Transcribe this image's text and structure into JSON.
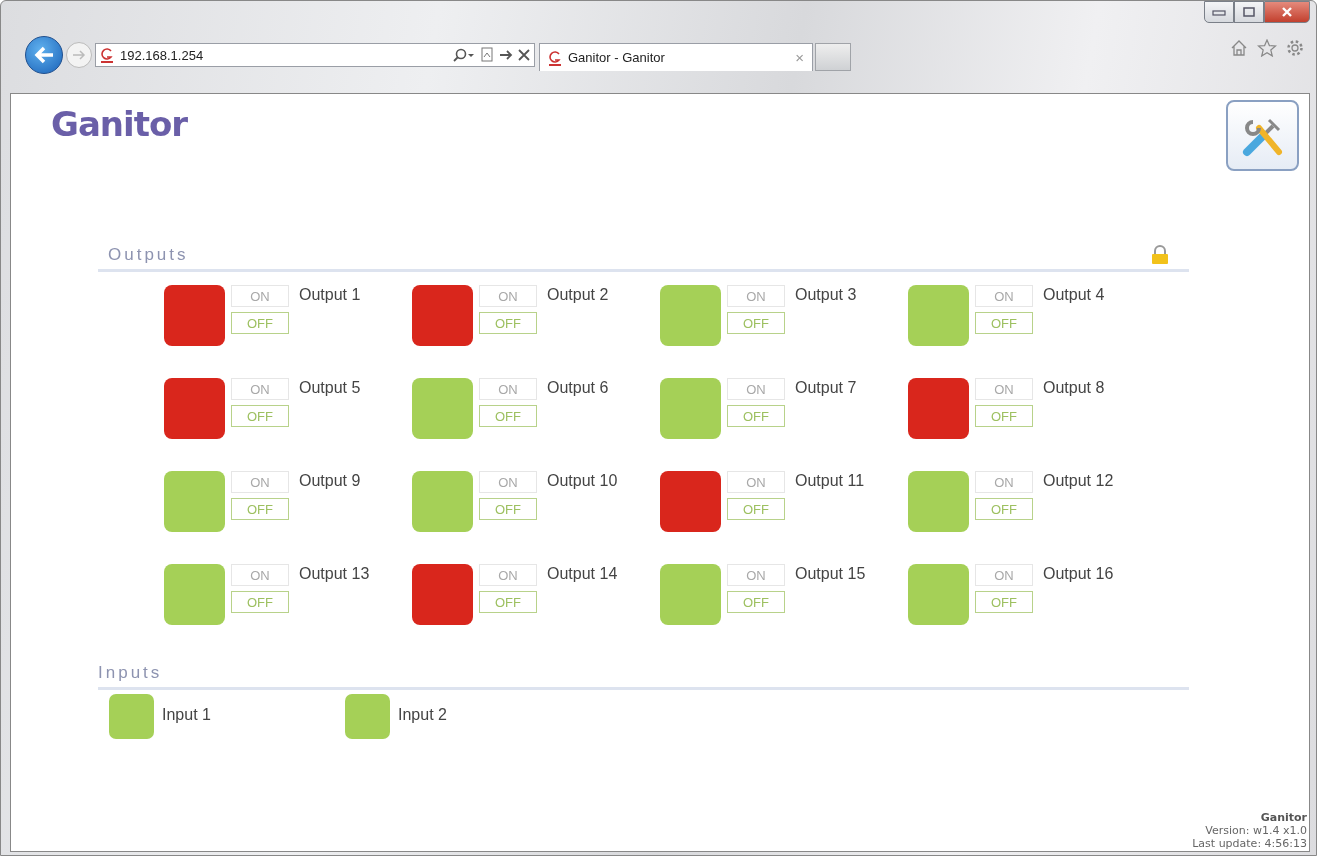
{
  "browser": {
    "address": "192.168.1.254",
    "tab": {
      "title": "Ganitor - Ganitor",
      "close": "×"
    }
  },
  "logo": "Ganitor",
  "outputs": {
    "title": "Outputs",
    "items": [
      {
        "name": "Output 1",
        "color": "#d9261c",
        "on_label": "ON",
        "off_label": "OFF"
      },
      {
        "name": "Output 2",
        "color": "#d9261c",
        "on_label": "ON",
        "off_label": "OFF"
      },
      {
        "name": "Output 3",
        "color": "#a5d057",
        "on_label": "ON",
        "off_label": "OFF"
      },
      {
        "name": "Output 4",
        "color": "#a5d057",
        "on_label": "ON",
        "off_label": "OFF"
      },
      {
        "name": "Output 5",
        "color": "#d9261c",
        "on_label": "ON",
        "off_label": "OFF"
      },
      {
        "name": "Output 6",
        "color": "#a5d057",
        "on_label": "ON",
        "off_label": "OFF"
      },
      {
        "name": "Output 7",
        "color": "#a5d057",
        "on_label": "ON",
        "off_label": "OFF"
      },
      {
        "name": "Output 8",
        "color": "#d9261c",
        "on_label": "ON",
        "off_label": "OFF"
      },
      {
        "name": "Output 9",
        "color": "#a5d057",
        "on_label": "ON",
        "off_label": "OFF"
      },
      {
        "name": "Output 10",
        "color": "#a5d057",
        "on_label": "ON",
        "off_label": "OFF"
      },
      {
        "name": "Output 11",
        "color": "#d9261c",
        "on_label": "ON",
        "off_label": "OFF"
      },
      {
        "name": "Output 12",
        "color": "#a5d057",
        "on_label": "ON",
        "off_label": "OFF"
      },
      {
        "name": "Output 13",
        "color": "#a5d057",
        "on_label": "ON",
        "off_label": "OFF"
      },
      {
        "name": "Output 14",
        "color": "#d9261c",
        "on_label": "ON",
        "off_label": "OFF"
      },
      {
        "name": "Output 15",
        "color": "#a5d057",
        "on_label": "ON",
        "off_label": "OFF"
      },
      {
        "name": "Output 16",
        "color": "#a5d057",
        "on_label": "ON",
        "off_label": "OFF"
      }
    ]
  },
  "inputs": {
    "title": "Inputs",
    "items": [
      {
        "name": "Input 1",
        "color": "#a5d057"
      },
      {
        "name": "Input 2",
        "color": "#a5d057"
      }
    ]
  },
  "footer": {
    "product": "Ganitor",
    "version": "Version: w1.4 x1.0",
    "last_update": "Last update: 4:56:13"
  }
}
